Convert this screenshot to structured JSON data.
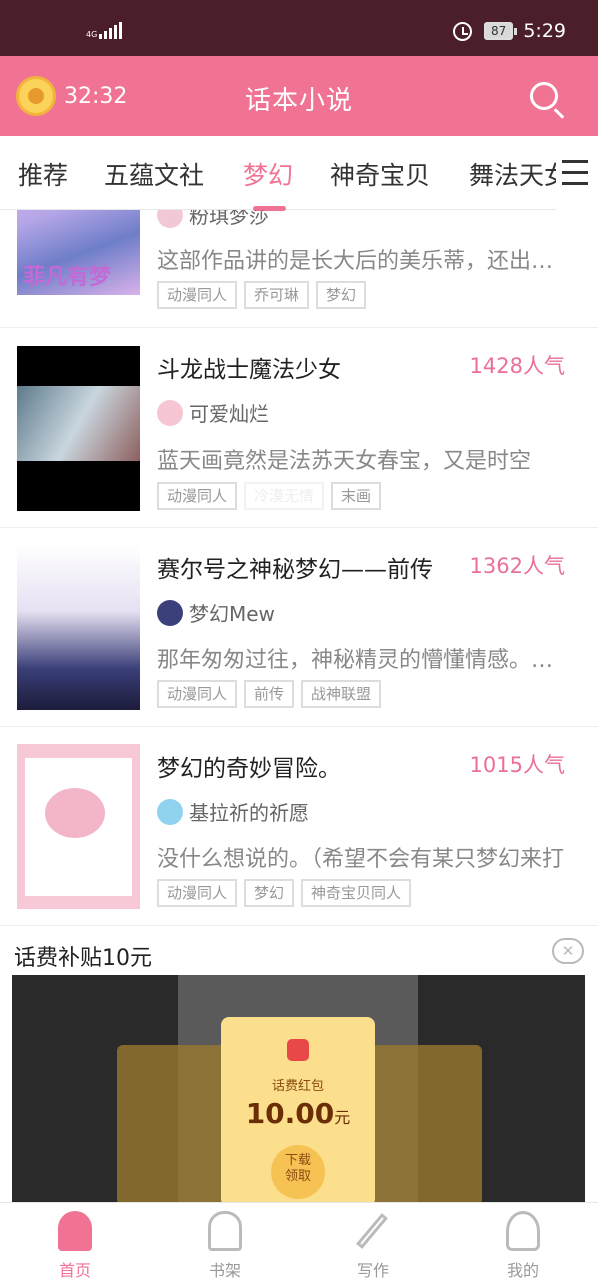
{
  "status": {
    "network": "4G",
    "battery": "87",
    "time": "5:29"
  },
  "header": {
    "timer": "32:32",
    "title": "话本小说"
  },
  "tabs": [
    {
      "label": "推荐"
    },
    {
      "label": "五蕴文社"
    },
    {
      "label": "梦幻"
    },
    {
      "label": "神奇宝贝"
    },
    {
      "label": "舞法天女"
    }
  ],
  "items": [
    {
      "title": "",
      "author": "粉琪梦莎",
      "desc": "这部作品讲的是长大后的美乐蒂，还出现了可爱的",
      "tags": [
        "动漫同人",
        "乔可琳",
        "梦幻"
      ],
      "cover_text": "菲凡有梦"
    },
    {
      "title": "斗龙战士魔法少女",
      "popularity": "1428人气",
      "author": "可爱灿烂",
      "desc": "蓝天画竟然是法苏天女春宝，又是时空",
      "tags": [
        "动漫同人",
        "冷漠无情",
        "末画"
      ]
    },
    {
      "title": "赛尔号之神秘梦幻——前传",
      "popularity": "1362人气",
      "author": "梦幻Mew",
      "desc": "那年匆匆过往，神秘精灵的懵懂情感。那年",
      "tags": [
        "动漫同人",
        "前传",
        "战神联盟"
      ]
    },
    {
      "title": "梦幻的奇妙冒险。",
      "popularity": "1015人气",
      "author": "基拉祈的祈愿",
      "desc": "没什么想说的。（希望不会有某只梦幻来打",
      "tags": [
        "动漫同人",
        "梦幻",
        "神奇宝贝同人"
      ]
    }
  ],
  "ad": {
    "title": "话费补贴10元",
    "card_label": "话费红包",
    "amount": "10.00",
    "unit": "元",
    "button_line1": "下载",
    "button_line2": "领取"
  },
  "nav": [
    {
      "label": "首页"
    },
    {
      "label": "书架"
    },
    {
      "label": "写作"
    },
    {
      "label": "我的"
    }
  ],
  "colors": {
    "brand": "#f07394",
    "status_bar": "#4b1f2a",
    "popularity": "#ea6f99"
  }
}
